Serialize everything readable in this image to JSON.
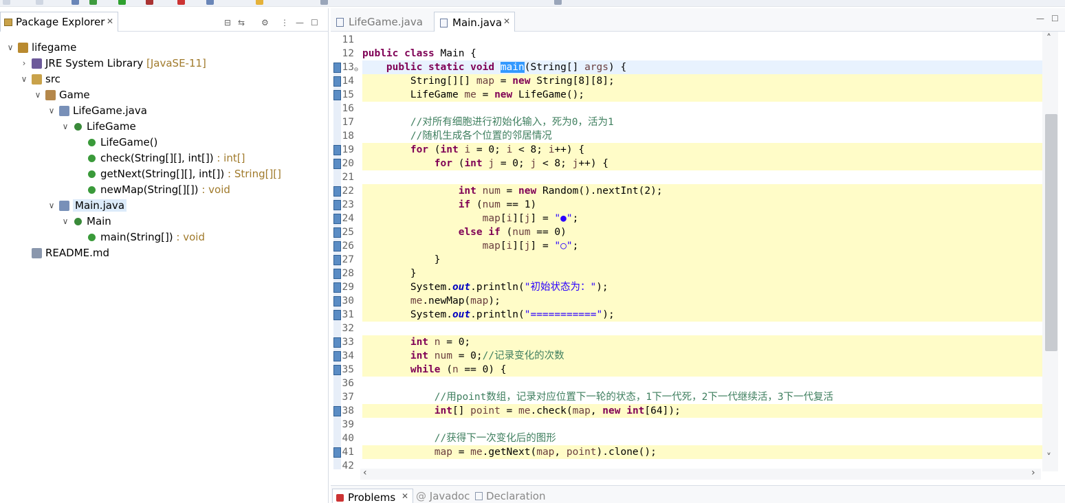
{
  "package_explorer": {
    "tab_title": "Package Explorer",
    "tree": [
      {
        "label": "lifegame",
        "deco": ""
      },
      {
        "label": "JRE System Library",
        "deco": " [JavaSE-11]"
      },
      {
        "label": "src",
        "deco": ""
      },
      {
        "label": "Game",
        "deco": ""
      },
      {
        "label": "LifeGame.java",
        "deco": ""
      },
      {
        "label": "LifeGame",
        "deco": ""
      },
      {
        "label": "LifeGame()",
        "deco": ""
      },
      {
        "label": "check(String[][], int[])",
        "deco": " : int[]"
      },
      {
        "label": "getNext(String[][], int[])",
        "deco": " : String[][]"
      },
      {
        "label": "newMap(String[][])",
        "deco": " : void"
      },
      {
        "label": "Main.java",
        "deco": ""
      },
      {
        "label": "Main",
        "deco": ""
      },
      {
        "label": "main(String[])",
        "deco": " : void"
      },
      {
        "label": "README.md",
        "deco": ""
      }
    ]
  },
  "editor": {
    "tabs": [
      {
        "label": "LifeGame.java",
        "active": false
      },
      {
        "label": "Main.java",
        "active": true
      }
    ],
    "lines": [
      {
        "num": "11",
        "code": ""
      },
      {
        "num": "12",
        "code": "public class Main {"
      },
      {
        "num": "13",
        "code": "    public static void main(String[] args) {"
      },
      {
        "num": "14",
        "code": "        String[][] map = new String[8][8];"
      },
      {
        "num": "15",
        "code": "        LifeGame me = new LifeGame();"
      },
      {
        "num": "16",
        "code": ""
      },
      {
        "num": "17",
        "code": "        //对所有细胞进行初始化输入，死为0，活为1"
      },
      {
        "num": "18",
        "code": "        //随机生成各个位置的邻居情况"
      },
      {
        "num": "19",
        "code": "        for (int i = 0; i < 8; i++) {"
      },
      {
        "num": "20",
        "code": "            for (int j = 0; j < 8; j++) {"
      },
      {
        "num": "21",
        "code": ""
      },
      {
        "num": "22",
        "code": "                int num = new Random().nextInt(2);"
      },
      {
        "num": "23",
        "code": "                if (num == 1)"
      },
      {
        "num": "24",
        "code": "                    map[i][j] = \"●\";"
      },
      {
        "num": "25",
        "code": "                else if (num == 0)"
      },
      {
        "num": "26",
        "code": "                    map[i][j] = \"○\";"
      },
      {
        "num": "27",
        "code": "            }"
      },
      {
        "num": "28",
        "code": "        }"
      },
      {
        "num": "29",
        "code": "        System.out.println(\"初始状态为：\");"
      },
      {
        "num": "30",
        "code": "        me.newMap(map);"
      },
      {
        "num": "31",
        "code": "        System.out.println(\"===========\");"
      },
      {
        "num": "32",
        "code": ""
      },
      {
        "num": "33",
        "code": "        int n = 0;"
      },
      {
        "num": "34",
        "code": "        int num = 0;//记录变化的次数"
      },
      {
        "num": "35",
        "code": "        while (n == 0) {"
      },
      {
        "num": "36",
        "code": ""
      },
      {
        "num": "37",
        "code": "            //用point数组，记录对应位置下一轮的状态，1下一代死，2下一代继续活，3下一代复活"
      },
      {
        "num": "38",
        "code": "            int[] point = me.check(map, new int[64]);"
      },
      {
        "num": "39",
        "code": ""
      },
      {
        "num": "40",
        "code": "            //获得下一次变化后的图形"
      },
      {
        "num": "41",
        "code": "            map = me.getNext(map, point).clone();"
      },
      {
        "num": "42",
        "code": ""
      }
    ]
  },
  "bottom_panel": {
    "tabs": [
      {
        "label": "Problems",
        "active": true
      },
      {
        "label": "Javadoc",
        "active": false
      },
      {
        "label": "Declaration",
        "active": false
      }
    ]
  },
  "colors": {
    "keyword": "#7f0055",
    "comment": "#3f7f5f",
    "string": "#2a00ff",
    "field": "#0000c0",
    "occurrence_highlight": "#fffcc8",
    "current_line": "#e8f2fe",
    "selection": "#3399ff"
  }
}
